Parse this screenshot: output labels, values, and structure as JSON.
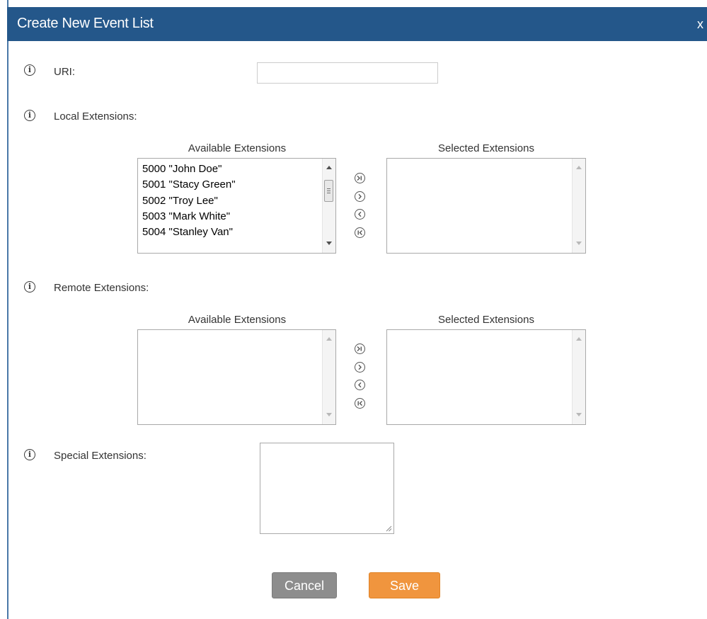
{
  "dialog": {
    "title": "Create New Event List",
    "close_label": "x"
  },
  "uri": {
    "label": "URI:",
    "value": "",
    "placeholder": ""
  },
  "local_extensions": {
    "label": "Local Extensions:",
    "available_header": "Available Extensions",
    "selected_header": "Selected Extensions",
    "available_items": [
      "5000 \"John Doe\"",
      "5001 \"Stacy Green\"",
      "5002 \"Troy Lee\"",
      "5003 \"Mark White\"",
      "5004 \"Stanley Van\""
    ],
    "selected_items": []
  },
  "remote_extensions": {
    "label": "Remote Extensions:",
    "available_header": "Available Extensions",
    "selected_header": "Selected Extensions",
    "available_items": [],
    "selected_items": []
  },
  "special_extensions": {
    "label": "Special Extensions:",
    "value": ""
  },
  "actions": {
    "cancel_label": "Cancel",
    "save_label": "Save"
  },
  "icons": {
    "info": "info-icon",
    "move_all_right": "double-chevron-right-icon",
    "move_right": "chevron-right-icon",
    "move_left": "chevron-left-icon",
    "move_all_left": "double-chevron-left-icon"
  },
  "colors": {
    "titlebar": "#24578a",
    "cancel": "#8d8d8d",
    "save": "#f0953e"
  }
}
